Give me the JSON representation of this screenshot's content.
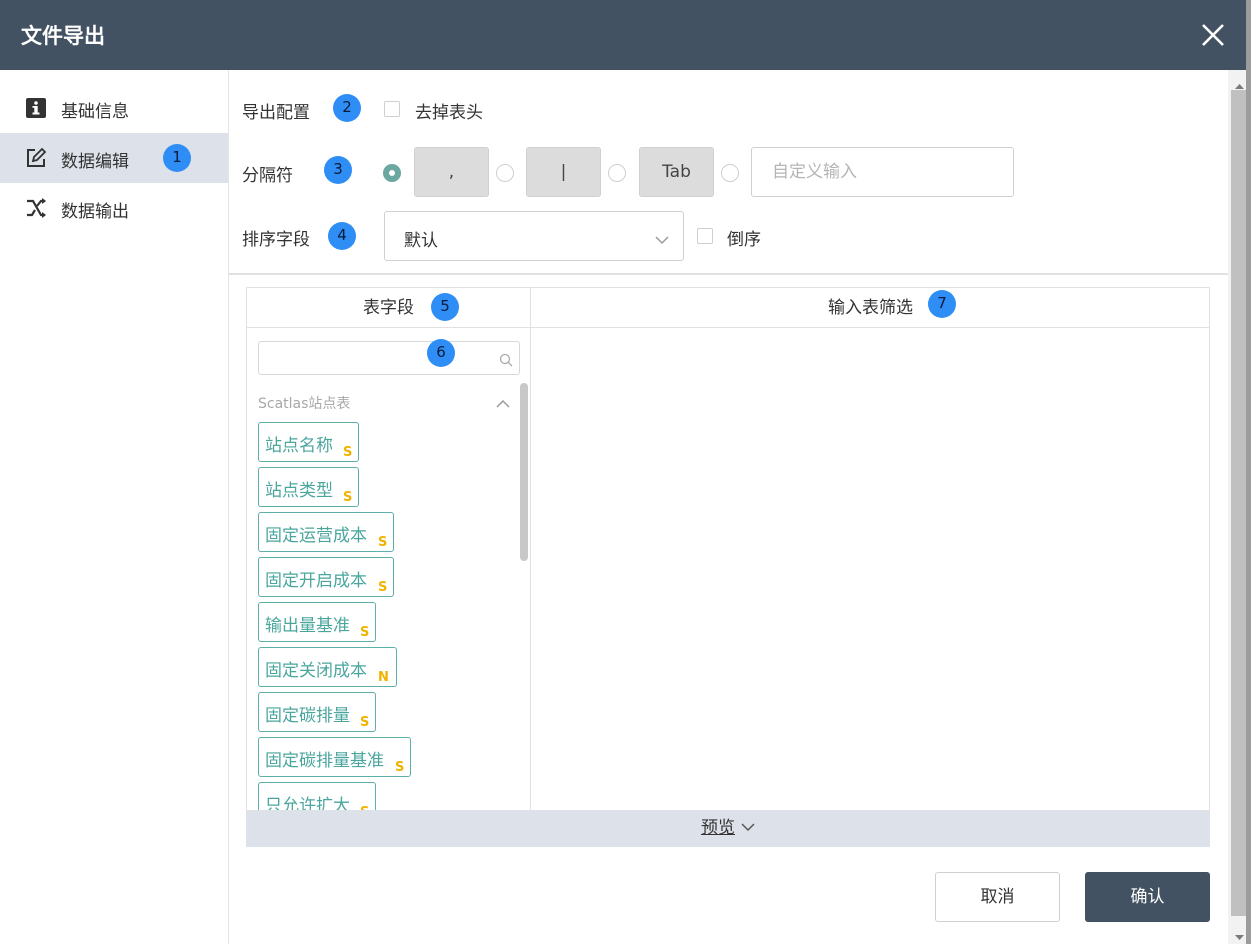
{
  "window": {
    "title": "文件导出"
  },
  "sidebar": {
    "items": [
      {
        "label": "基础信息",
        "icon": "info-icon"
      },
      {
        "label": "数据编辑",
        "icon": "edit-icon",
        "active": true
      },
      {
        "label": "数据输出",
        "icon": "shuffle-icon"
      }
    ]
  },
  "badges": {
    "b1": "1",
    "b2": "2",
    "b3": "3",
    "b4": "4",
    "b5": "5",
    "b6": "6",
    "b7": "7"
  },
  "export_config": {
    "label": "导出配置",
    "remove_header_label": "去掉表头",
    "remove_header_checked": false
  },
  "delimiter": {
    "label": "分隔符",
    "options": [
      ",",
      "|",
      "Tab"
    ],
    "selected_index": 0,
    "custom_placeholder": "自定义输入"
  },
  "sort": {
    "label": "排序字段",
    "value": "默认",
    "reverse_label": "倒序",
    "reverse_checked": false
  },
  "table_fields": {
    "header": "表字段",
    "search_placeholder": "",
    "group_title": "Scatlas站点表",
    "group_expanded": true,
    "fields": [
      {
        "name": "站点名称",
        "type": "S"
      },
      {
        "name": "站点类型",
        "type": "S"
      },
      {
        "name": "固定运营成本",
        "type": "S"
      },
      {
        "name": "固定开启成本",
        "type": "S"
      },
      {
        "name": "输出量基准",
        "type": "S"
      },
      {
        "name": "固定关闭成本",
        "type": "N"
      },
      {
        "name": "固定碳排量",
        "type": "S"
      },
      {
        "name": "固定碳排量基准",
        "type": "S"
      },
      {
        "name": "只允许扩大",
        "type": "S"
      }
    ]
  },
  "input_filter": {
    "header": "输入表筛选"
  },
  "preview": {
    "label": "预览"
  },
  "footer": {
    "cancel_label": "取消",
    "ok_label": "确认"
  },
  "colors": {
    "header_bg": "#425262",
    "accent_teal": "#4aa69d",
    "badge_blue": "#2e8ef5",
    "type_yellow": "#f0b400",
    "active_bg": "#dde2ea"
  }
}
